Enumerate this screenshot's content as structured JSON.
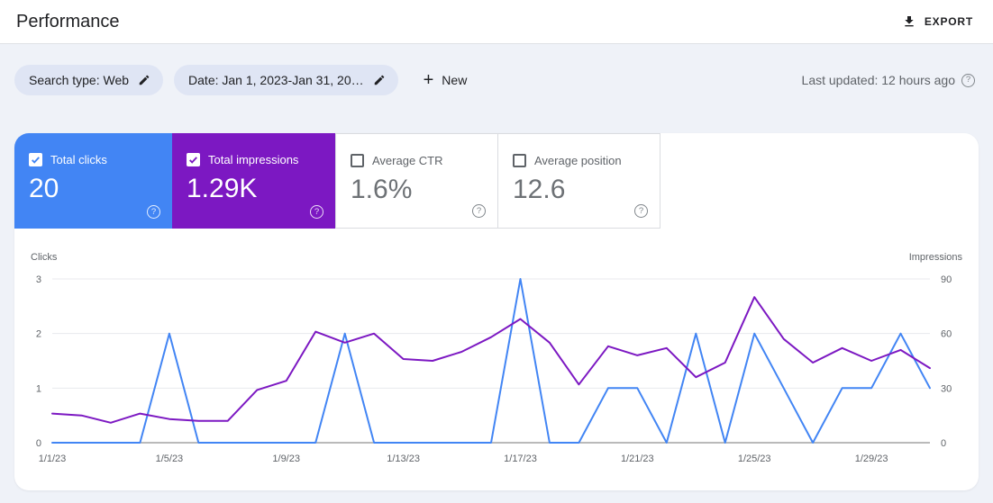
{
  "header": {
    "title": "Performance",
    "export_label": "EXPORT"
  },
  "filters": {
    "search_type": {
      "label": "Search type: Web"
    },
    "date_range": {
      "label": "Date: Jan 1, 2023-Jan 31, 20…"
    },
    "new_button": {
      "label": "New",
      "plus_glyph": "+"
    },
    "last_updated": "Last updated: 12 hours ago"
  },
  "icons": {
    "help_glyph": "?"
  },
  "metrics": [
    {
      "label": "Total clicks",
      "value": "20",
      "selected": true,
      "color": "#4285f4"
    },
    {
      "label": "Total impressions",
      "value": "1.29K",
      "selected": true,
      "color": "#7c18c2"
    },
    {
      "label": "Average CTR",
      "value": "1.6%",
      "selected": false
    },
    {
      "label": "Average position",
      "value": "12.6",
      "selected": false
    }
  ],
  "chart_data": {
    "type": "line",
    "title": "",
    "grid": "horizontal",
    "legend": "none",
    "left_axis": {
      "label": "Clicks",
      "range": [
        0,
        3
      ],
      "ticks": [
        0,
        1,
        2,
        3
      ]
    },
    "right_axis": {
      "label": "Impressions",
      "range": [
        0,
        90
      ],
      "ticks": [
        0,
        30,
        60,
        90
      ]
    },
    "x": [
      "1/1/23",
      "1/2/23",
      "1/3/23",
      "1/4/23",
      "1/5/23",
      "1/6/23",
      "1/7/23",
      "1/8/23",
      "1/9/23",
      "1/10/23",
      "1/11/23",
      "1/12/23",
      "1/13/23",
      "1/14/23",
      "1/15/23",
      "1/16/23",
      "1/17/23",
      "1/18/23",
      "1/19/23",
      "1/20/23",
      "1/21/23",
      "1/22/23",
      "1/23/23",
      "1/24/23",
      "1/25/23",
      "1/26/23",
      "1/27/23",
      "1/28/23",
      "1/29/23",
      "1/30/23",
      "1/31/23"
    ],
    "x_tick_labels": [
      "1/1/23",
      "1/5/23",
      "1/9/23",
      "1/13/23",
      "1/17/23",
      "1/21/23",
      "1/25/23",
      "1/29/23"
    ],
    "series": [
      {
        "name": "Total clicks",
        "axis": "left",
        "color": "#4285f4",
        "values": [
          0,
          0,
          0,
          0,
          2,
          0,
          0,
          0,
          0,
          0,
          2,
          0,
          0,
          0,
          0,
          0,
          3,
          0,
          0,
          1,
          1,
          0,
          2,
          0,
          2,
          1,
          0,
          1,
          1,
          2,
          1
        ]
      },
      {
        "name": "Total impressions",
        "axis": "right",
        "color": "#7c18c2",
        "values": [
          16,
          15,
          11,
          16,
          13,
          12,
          12,
          29,
          34,
          61,
          55,
          60,
          46,
          45,
          50,
          58,
          68,
          55,
          32,
          53,
          48,
          52,
          36,
          44,
          80,
          57,
          44,
          52,
          45,
          51,
          41
        ]
      }
    ]
  }
}
